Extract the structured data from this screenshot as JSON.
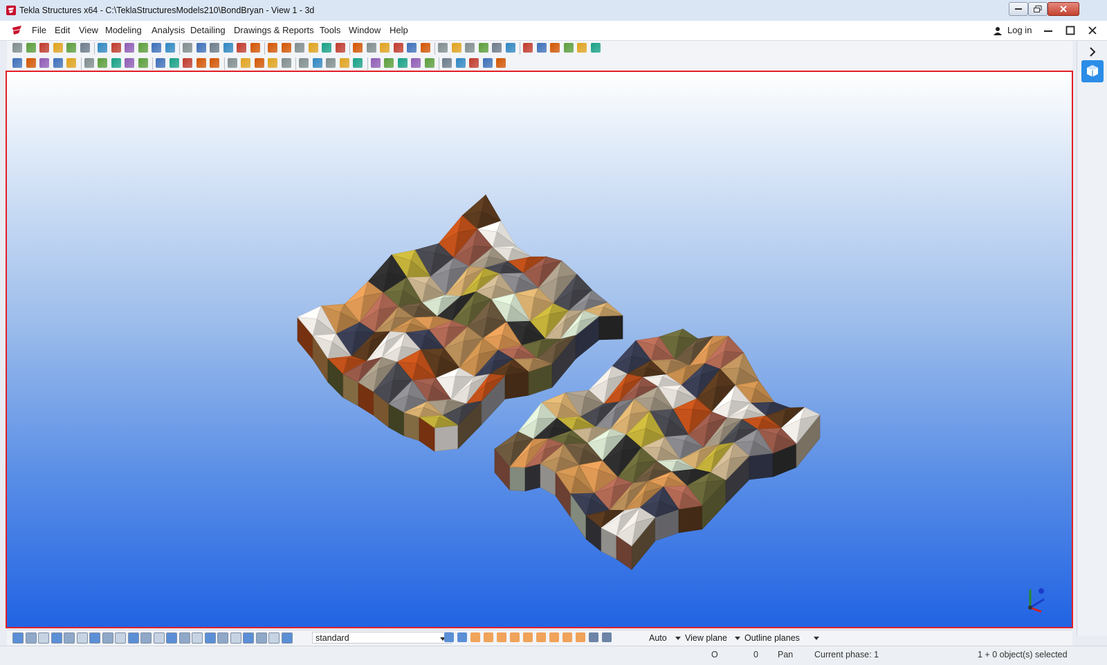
{
  "window": {
    "title": "Tekla Structures x64 - C:\\TeklaStructuresModels210\\BondBryan  - View 1 - 3d"
  },
  "menu": {
    "items": [
      "File",
      "Edit",
      "View",
      "Modeling",
      "Analysis",
      "Detailing",
      "Drawings & Reports",
      "Tools",
      "Window",
      "Help"
    ],
    "login_label": "Log in"
  },
  "toolbar_icons": {
    "row1": [
      "new-model-icon",
      "open-model-icon",
      "save-icon",
      "share-icon",
      "gray-part-icon",
      "gray-part-icon",
      "gray-part-icon",
      "gray-part-icon",
      "undo-icon",
      "redo-icon",
      "print-icon",
      "copy-icon",
      "paste-icon",
      "list-icon",
      "window-icon",
      "window-icon",
      "window-icon",
      "cut-icon",
      "select-icon",
      "component-icon",
      "component-icon",
      "component-icon",
      "component-icon",
      "inquire-icon",
      "grid-icon",
      "grid-icon",
      "help-icon",
      "dimension-icon",
      "dimension-icon",
      "dimension-icon",
      "dimension-icon",
      "dimension-icon",
      "arrow-icon",
      "layout-icon",
      "layout-icon",
      "layout-icon",
      "layout-icon",
      "report-icon",
      "report-icon",
      "more-icon",
      "folder-icon",
      "report-icon"
    ],
    "row2": [
      "plate-icon",
      "plate-icon",
      "column-icon",
      "beam-icon",
      "polybeam-icon",
      "slab-icon",
      "panel-icon",
      "item-icon",
      "bolt-icon",
      "weld-icon",
      "rebar-icon",
      "column-icon",
      "beam-icon",
      "curved-beam-icon",
      "beam-icon",
      "beam-icon",
      "pour-icon",
      "pad-icon",
      "binoculars-icon",
      "filter-icon",
      "component-icon",
      "cube-icon",
      "rebar-icon",
      "rebar-icon",
      "rebar-icon",
      "rebar-icon",
      "rebar-icon",
      "snap-icon",
      "snap-icon",
      "snap-icon",
      "snap-icon",
      "snap-icon",
      "snap-icon",
      "snap-icon",
      "snap-icon"
    ]
  },
  "select_toolbar": {
    "filter_value": "standard",
    "options": [
      "Auto",
      "View plane",
      "Outline planes"
    ]
  },
  "statusbar": {
    "x_value": "O",
    "y_value": "0",
    "mode": "Pan",
    "phase": "Current phase: 1",
    "selection": "1 + 0 object(s) selected"
  },
  "colors": {
    "viewport_border": "#e41e26",
    "viewport_bg_top": "#ffffff",
    "viewport_bg_bottom": "#2163e4",
    "accent": "#2b8de8"
  }
}
